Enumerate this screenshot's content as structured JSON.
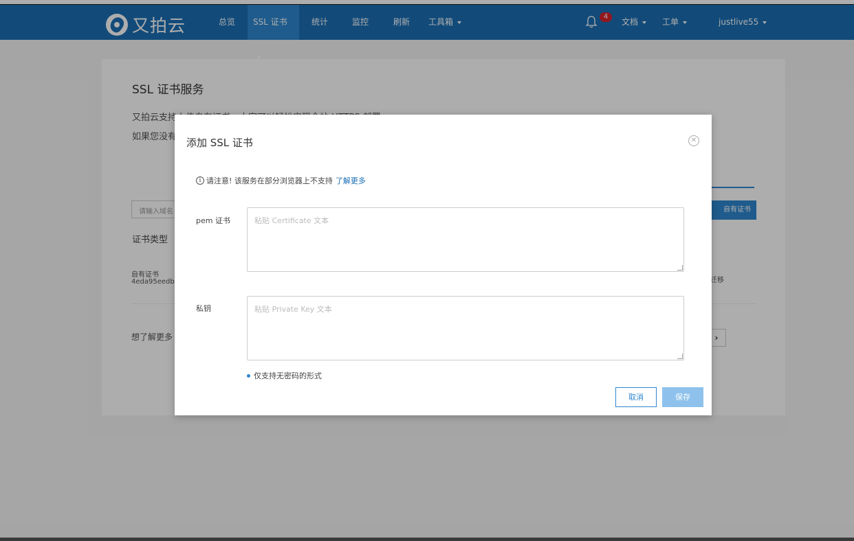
{
  "app": {
    "logo_text": "又拍云"
  },
  "nav": {
    "items": [
      {
        "label": "总览"
      },
      {
        "label": "SSL 证书"
      },
      {
        "label": "统计"
      },
      {
        "label": "监控"
      },
      {
        "label": "刷新"
      },
      {
        "label": "工具箱"
      }
    ],
    "notification_count": "4",
    "right_items": [
      {
        "label": "文档"
      },
      {
        "label": "工单"
      },
      {
        "label": "justlive55"
      }
    ]
  },
  "page": {
    "title": "SSL 证书服务",
    "desc_line1": "又拍云支持上传自有证书，大家可以轻松实现全站 HTTPS 部署",
    "desc_line2": "如果您没有",
    "domain_placeholder": "请输入域名",
    "upload_button": "自有证书",
    "cert_type_label": "证书类型",
    "row": {
      "type": "自有证书",
      "id": "4eda95eedb",
      "action": "迁移"
    },
    "learn_more": "想了解更多"
  },
  "modal": {
    "title": "添加 SSL 证书",
    "notice_text": "请注意! 该服务在部分浏览器上不支持",
    "notice_link": "了解更多",
    "pem_label": "pem 证书",
    "pem_placeholder": "粘贴 Certificate 文本",
    "key_label": "私钥",
    "key_placeholder": "粘贴 Private Key 文本",
    "hint": "仅支持无密码的形式",
    "cancel": "取消",
    "save": "保存"
  },
  "colors": {
    "brand": "#1b6fb4",
    "accent": "#2f86cf",
    "badge": "#d9232d"
  }
}
